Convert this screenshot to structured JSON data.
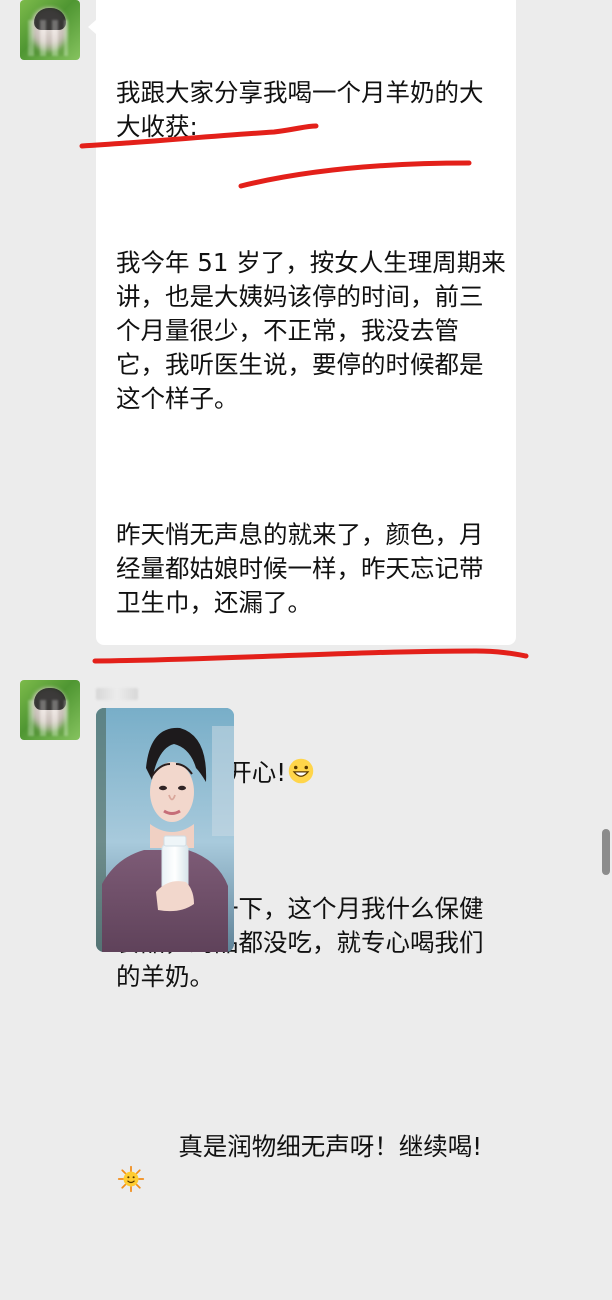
{
  "app": {
    "colors": {
      "background": "#ececec",
      "bubble": "#ffffff",
      "text": "#111111",
      "annotation": "#e3201a",
      "scrollbar": "#8c8c8c"
    }
  },
  "messages": [
    {
      "avatar_icon": "blurred-avatar",
      "paragraphs": [
        "我跟大家分享我喝一个月羊奶的大大收获:",
        "我今年 51 岁了，按女人生理周期来讲，也是大姨妈该停的时间，前三个月量很少，不正常，我没去管它，我听医生说，要停的时候都是这个样子。",
        "昨天悄无声息的就来了，颜色，月经量都姑娘时候一样，昨天忘记带卫生巾，还漏了。",
        "有点开心!",
        "我回忆了一下，这个月我什么保健食品，药品都没吃，就专心喝我们的羊奶。",
        "真是润物细无声呀！继续喝!"
      ],
      "emojis": [
        "grinning-emoji",
        "sun-emoji"
      ]
    },
    {
      "avatar_icon": "blurred-avatar",
      "sender_name_blurred": true,
      "image": {
        "type": "photo",
        "subject": "woman-holding-milk-bottle"
      }
    }
  ]
}
